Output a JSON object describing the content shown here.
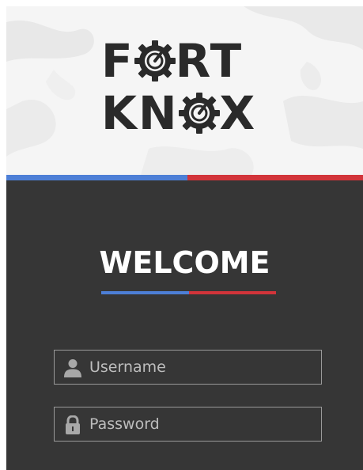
{
  "logo": {
    "line1_before": "F",
    "line1_after": "RT",
    "line2_before": "KN",
    "line2_after": "X"
  },
  "stripe_colors": {
    "blue": "#4d7fd6",
    "red": "#d2343a"
  },
  "panel": {
    "background": "#363636",
    "heading": "WELCOME"
  },
  "form": {
    "username": {
      "placeholder": "Username",
      "value": "",
      "icon": "user-icon"
    },
    "password": {
      "placeholder": "Password",
      "value": "",
      "icon": "lock-icon"
    }
  }
}
